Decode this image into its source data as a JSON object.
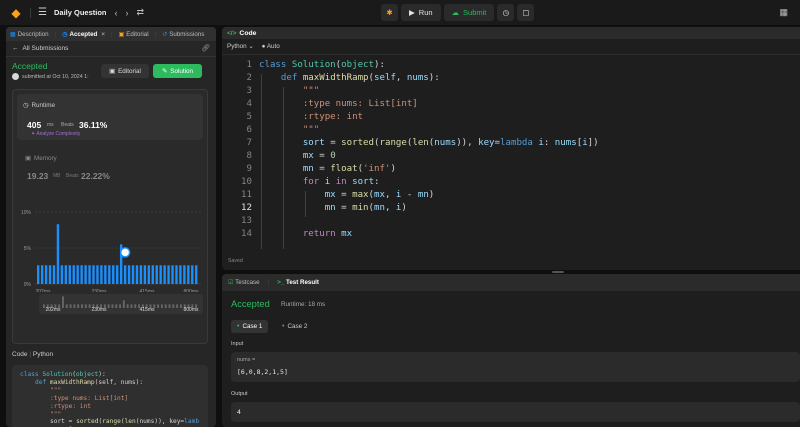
{
  "topbar": {
    "title": "Daily Question",
    "run_label": "Run",
    "submit_label": "Submit"
  },
  "left": {
    "tabs": [
      {
        "label": "Description",
        "icon": "description-icon"
      },
      {
        "label": "Accepted",
        "icon": "clock-icon"
      },
      {
        "label": "Editorial",
        "icon": "book-icon"
      },
      {
        "label": "Submissions",
        "icon": "history-icon"
      }
    ],
    "back_label": "All Submissions",
    "status": "Accepted",
    "submitted_text": "submitted at Oct 10, 2024 1:",
    "editorial_label": "Editorial",
    "solution_label": "Solution",
    "runtime": {
      "label": "Runtime",
      "value": "405",
      "unit": "ms",
      "beats_label": "Beats",
      "beats_value": "36.11%",
      "analyze": "Analyze Complexity"
    },
    "memory": {
      "label": "Memory",
      "value": "19.23",
      "unit": "MB",
      "beats_label": "Beats",
      "beats_value": "22.22%"
    },
    "code_label": "Code",
    "code_lang": "Python",
    "code_lines": [
      "class Solution(object):",
      "    def maxWidthRamp(self, nums):",
      "        \"\"\"",
      "        :type nums: List[int]",
      "        :rtype: int",
      "        \"\"\"",
      "        sort = sorted(range(len(nums)), key=lamb",
      "        mx = 0"
    ]
  },
  "chart_data": {
    "type": "bar",
    "y_ticks": [
      "10%",
      "5%",
      "0%"
    ],
    "x_ticks": [
      "202ms",
      "230ms",
      "415ms",
      "800ms"
    ],
    "mini_x_ticks": [
      "202ms",
      "230ms",
      "415ms",
      "800ms"
    ],
    "ylim": [
      0,
      10
    ],
    "values": [
      2.6,
      2.6,
      2.6,
      2.6,
      2.6,
      8.3,
      2.6,
      2.6,
      2.6,
      2.6,
      2.6,
      2.6,
      2.6,
      2.6,
      2.6,
      2.6,
      2.6,
      2.6,
      2.6,
      2.6,
      2.6,
      5.5,
      2.6,
      2.6,
      2.6,
      2.6,
      2.6,
      2.6,
      2.6,
      2.6,
      2.6,
      2.6,
      2.6,
      2.6,
      2.6,
      2.6,
      2.6,
      2.6,
      2.6,
      2.6,
      2.6
    ],
    "highlight_index": 21,
    "color": "#1a90ff"
  },
  "editor": {
    "header": "Code",
    "language": "Python",
    "auto_label": "Auto",
    "line_numbers": [
      "1",
      "2",
      "3",
      "4",
      "5",
      "6",
      "7",
      "8",
      "9",
      "10",
      "11",
      "12",
      "13",
      "14"
    ],
    "current_line": 12,
    "saved": "Saved"
  },
  "result": {
    "tab_testcase": "Testcase",
    "tab_result": "Test Result",
    "status": "Accepted",
    "runtime": "Runtime: 18 ms",
    "cases": [
      "Case 1",
      "Case 2"
    ],
    "input_label": "Input",
    "input_key": "nums =",
    "input_value": "[6,0,8,2,1,5]",
    "output_label": "Output",
    "output_value": "4"
  },
  "colors": {
    "accent_green": "#2cbb5d",
    "bar_blue": "#1a90ff",
    "brand_orange": "#ffa116"
  }
}
